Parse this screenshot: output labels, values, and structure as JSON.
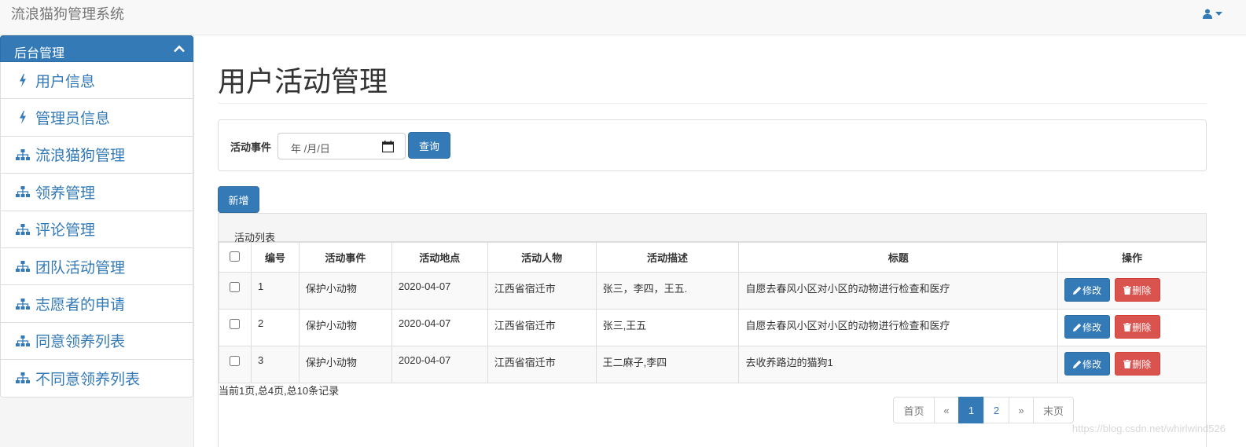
{
  "app": {
    "title": "流浪猫狗管理系统"
  },
  "colors": {
    "primary": "#337ab7",
    "danger": "#d9534f"
  },
  "sidebar": {
    "header": "后台管理",
    "items": [
      {
        "label": "用户信息",
        "icon": "bolt-icon"
      },
      {
        "label": "管理员信息",
        "icon": "bolt-icon"
      },
      {
        "label": "流浪猫狗管理",
        "icon": "sitemap-icon"
      },
      {
        "label": "领养管理",
        "icon": "sitemap-icon"
      },
      {
        "label": "评论管理",
        "icon": "sitemap-icon"
      },
      {
        "label": "团队活动管理",
        "icon": "sitemap-icon"
      },
      {
        "label": "志愿者的申请",
        "icon": "sitemap-icon"
      },
      {
        "label": "同意领养列表",
        "icon": "sitemap-icon"
      },
      {
        "label": "不同意领养列表",
        "icon": "sitemap-icon"
      }
    ]
  },
  "main": {
    "title": "用户活动管理",
    "search": {
      "label": "活动事件",
      "date_placeholder": "年 /月/日",
      "query_label": "查询"
    },
    "add_label": "新增",
    "table": {
      "caption": "活动列表",
      "headers": [
        "编号",
        "活动事件",
        "活动地点",
        "活动人物",
        "活动描述",
        "标题",
        "操作"
      ],
      "rows": [
        {
          "id": "1",
          "event": "保护小动物",
          "place": "2020-04-07",
          "person": "江西省宿迁市",
          "desc": "张三，李四，王五.",
          "title": "自愿去春风小区对小区的动物进行检查和医疗"
        },
        {
          "id": "2",
          "event": "保护小动物",
          "place": "2020-04-07",
          "person": "江西省宿迁市",
          "desc": "张三,王五",
          "title": "自愿去春风小区对小区的动物进行检查和医疗"
        },
        {
          "id": "3",
          "event": "保护小动物",
          "place": "2020-04-07",
          "person": "江西省宿迁市",
          "desc": "王二麻子,李四",
          "title": "去收养路边的猫狗1"
        }
      ],
      "edit_label": "修改",
      "delete_label": "删除"
    },
    "record_info": "当前1页,总4页,总10条记录",
    "pagination": {
      "first": "首页",
      "prev": "«",
      "pages": [
        "1",
        "2"
      ],
      "current": "1",
      "next": "»",
      "last": "末页"
    }
  },
  "watermark": "https://blog.csdn.net/whirlwind526"
}
